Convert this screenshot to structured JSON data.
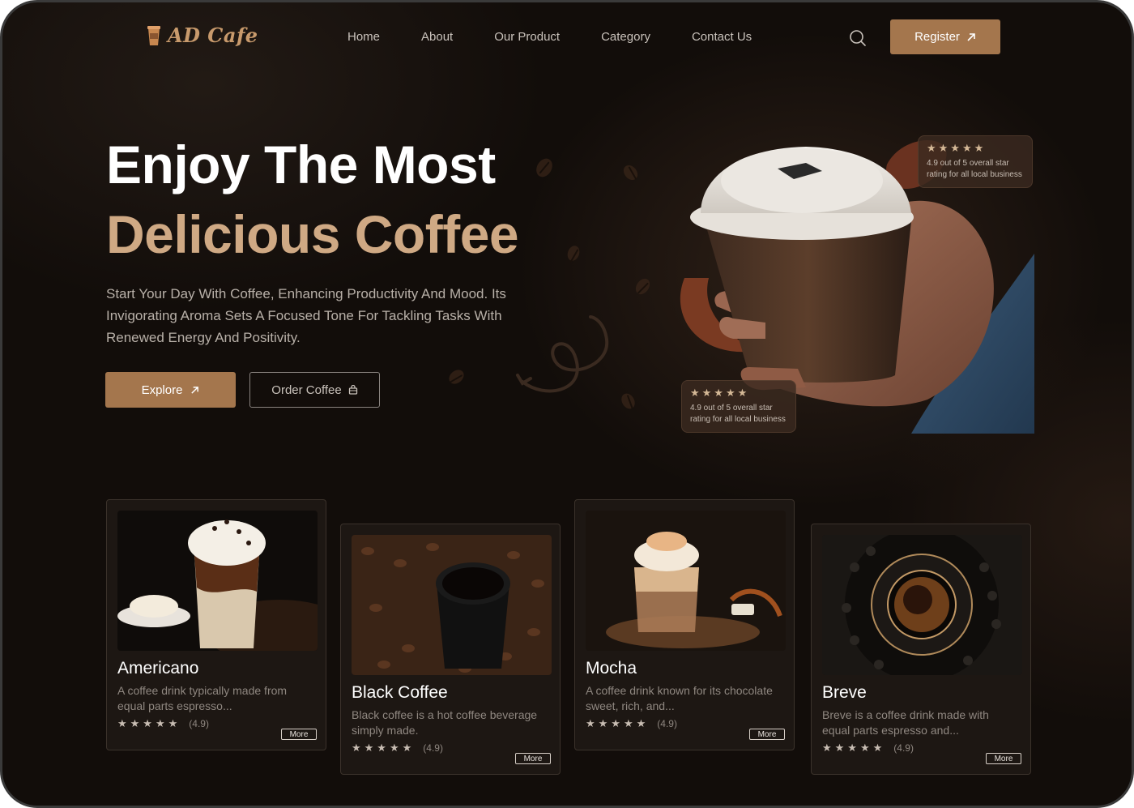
{
  "brand": {
    "name": "AD Cafe"
  },
  "nav": {
    "items": [
      "Home",
      "About",
      "Our Product",
      "Category",
      "Contact Us"
    ],
    "register_label": "Register"
  },
  "hero": {
    "title_line1": "Enjoy The Most",
    "title_line2": "Delicious Coffee",
    "description": "Start Your Day With Coffee, Enhancing Productivity And Mood. Its Invigorating Aroma Sets A Focused Tone For Tackling Tasks With Renewed Energy And Positivity.",
    "explore_label": "Explore",
    "order_label": "Order Coffee"
  },
  "ratings": [
    {
      "stars": "★★★★★",
      "text": "4.9 out of 5 overall star rating for all local business"
    },
    {
      "stars": "★★★★★",
      "text": "4.9 out of 5 overall star rating for all local business"
    }
  ],
  "products": [
    {
      "name": "Americano",
      "desc": "A coffee drink typically made from equal parts espresso...",
      "stars": "★★★★★",
      "rating": "(4.9)",
      "more": "More"
    },
    {
      "name": "Black Coffee",
      "desc": "Black coffee is a hot coffee beverage simply made.",
      "stars": "★★★★★",
      "rating": "(4.9)",
      "more": "More"
    },
    {
      "name": "Mocha",
      "desc": "A coffee drink known for its chocolate sweet, rich, and...",
      "stars": "★★★★★",
      "rating": "(4.9)",
      "more": "More"
    },
    {
      "name": "Breve",
      "desc": "Breve is a coffee drink made with equal parts espresso and...",
      "stars": "★★★★★",
      "rating": "(4.9)",
      "more": "More"
    }
  ],
  "colors": {
    "accent": "#a4764d",
    "gold_text": "#cfa984",
    "background": "#120d0a"
  }
}
